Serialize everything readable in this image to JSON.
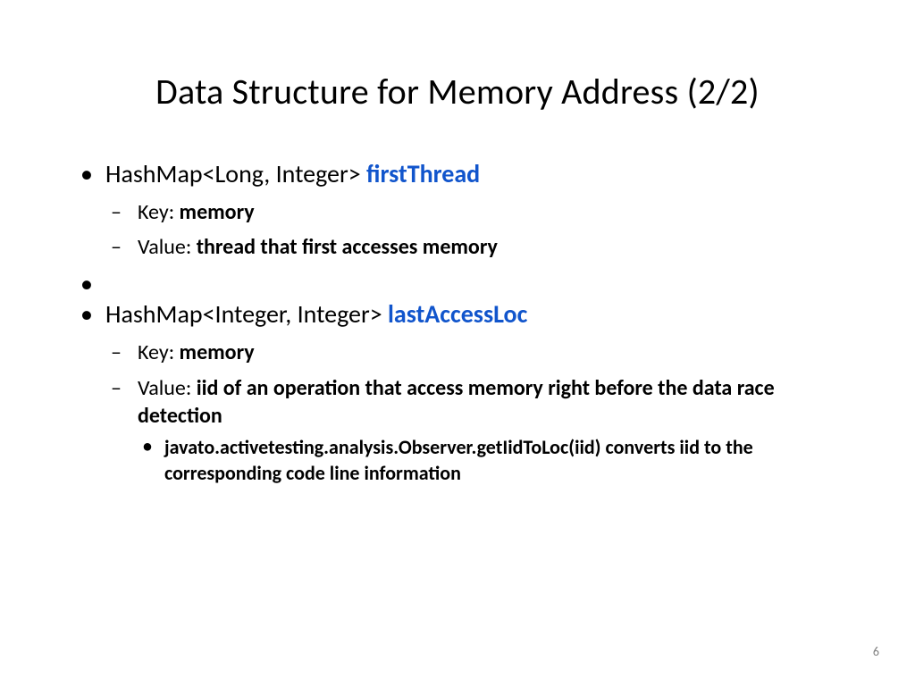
{
  "title": "Data Structure for Memory Address (2/2)",
  "items": [
    {
      "type_label": "HashMap<Long, Integer> ",
      "name": "firstThread",
      "key_label": "Key: ",
      "key_value": "memory",
      "value_label": "Value: ",
      "value_value": "thread that first accesses memory",
      "sub": null
    },
    {
      "type_label": "HashMap<Integer, Integer> ",
      "name": "lastAccessLoc",
      "key_label": "Key: ",
      "key_value": "memory",
      "value_label": "Value: ",
      "value_value": "iid of an operation that access memory right before the data race detection",
      "sub": "javato.activetesting.analysis.Observer.getIidToLoc(iid) converts iid to the corresponding code line information"
    }
  ],
  "page_number": "6"
}
